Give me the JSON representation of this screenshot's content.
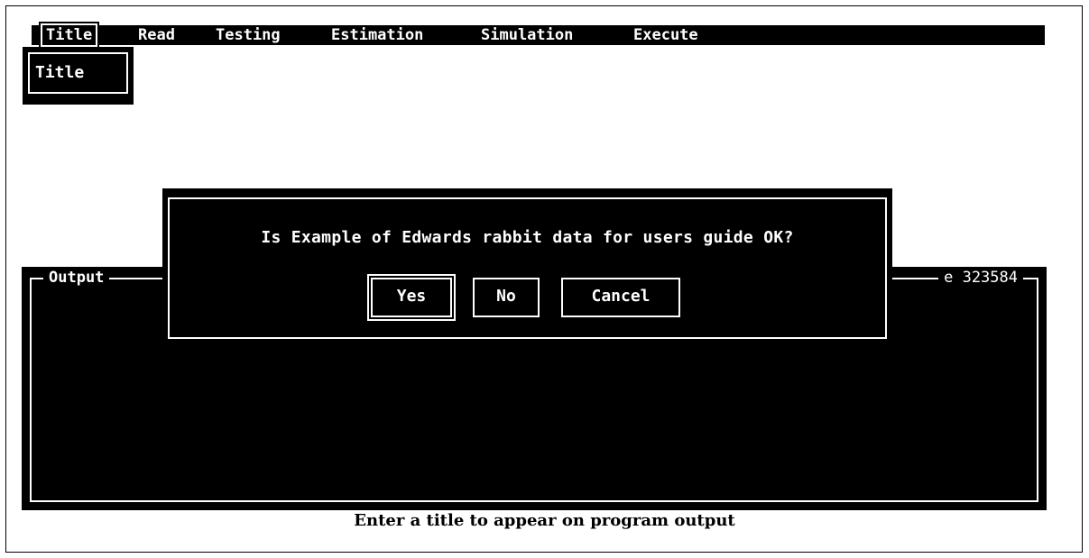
{
  "menubar": {
    "items": [
      {
        "label": "Title"
      },
      {
        "label": "Read"
      },
      {
        "label": "Testing"
      },
      {
        "label": "Estimation"
      },
      {
        "label": "Simulation"
      },
      {
        "label": "Execute"
      }
    ]
  },
  "submenu": {
    "items": [
      {
        "label": "Title"
      }
    ]
  },
  "output": {
    "label": "Output",
    "right_text": "e 323584"
  },
  "dialog": {
    "message": "Is Example of Edwards rabbit data for users guide OK?",
    "buttons": {
      "yes": "Yes",
      "no": "No",
      "cancel": "Cancel"
    }
  },
  "status": {
    "text": "Enter a title to appear on program output"
  },
  "colors": {
    "background": "#ffffff",
    "panel": "#000000",
    "text_on_panel": "#ffffff"
  }
}
